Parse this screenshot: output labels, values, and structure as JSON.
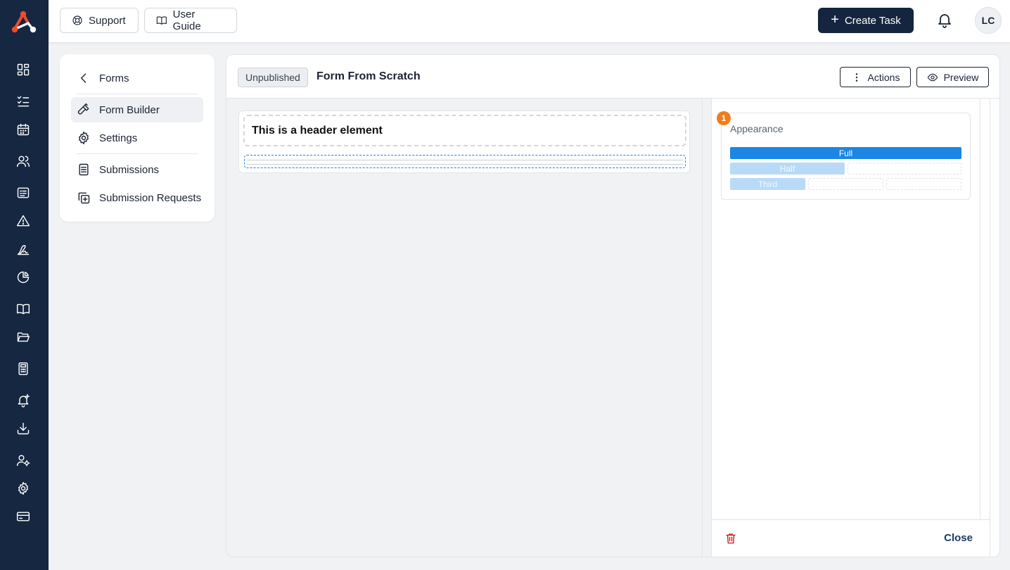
{
  "topbar": {
    "support_label": "Support",
    "user_guide_label": "User Guide",
    "create_task_label": "Create Task",
    "avatar_initials": "LC"
  },
  "nav": {
    "back_label": "Forms",
    "items": [
      {
        "label": "Form Builder",
        "icon": "hammer-icon",
        "active": true
      },
      {
        "label": "Settings",
        "icon": "gear-icon"
      },
      {
        "label": "Submissions",
        "icon": "document-icon"
      },
      {
        "label": "Submission Requests",
        "icon": "copy-plus-icon"
      }
    ]
  },
  "form": {
    "status_badge": "Unpublished",
    "title": "Form From Scratch",
    "actions_label": "Actions",
    "preview_label": "Preview"
  },
  "canvas": {
    "header_element_text": "This is a header element"
  },
  "panel": {
    "step_number": "1",
    "appearance_title": "Appearance",
    "widths": {
      "full": "Full",
      "half": "Half",
      "third": "Third"
    },
    "close_label": "Close"
  },
  "colors": {
    "rail": "#152741",
    "accent": "#1b86e4",
    "accent_soft": "#b9daf7",
    "badge_orange": "#f07d1c",
    "danger": "#d3131b",
    "primary_button": "#15253f"
  }
}
